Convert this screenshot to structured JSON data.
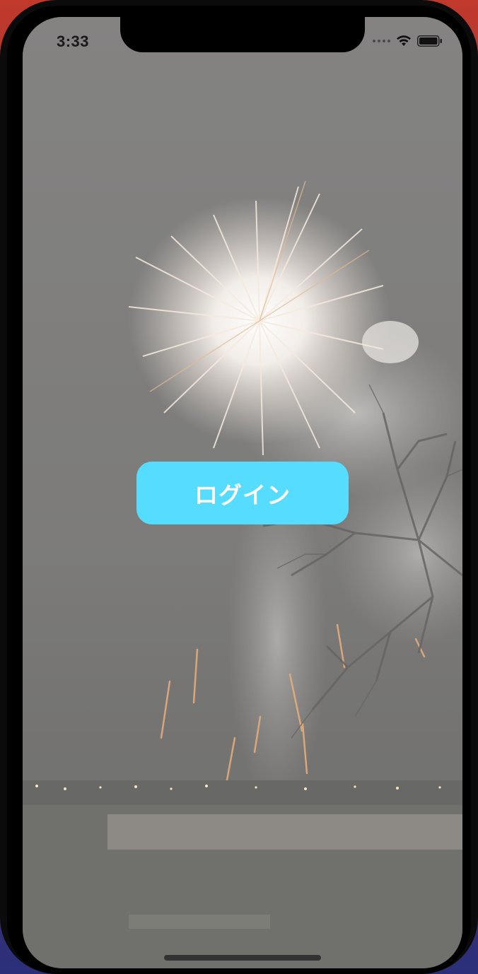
{
  "status_bar": {
    "time": "3:33",
    "wifi_icon": "wifi-icon",
    "battery_icon": "battery-icon",
    "signal_icon": "signal-dots-icon"
  },
  "main": {
    "login_label": "ログイン"
  },
  "colors": {
    "button": "#55dcff",
    "button_text": "#ffffff"
  }
}
